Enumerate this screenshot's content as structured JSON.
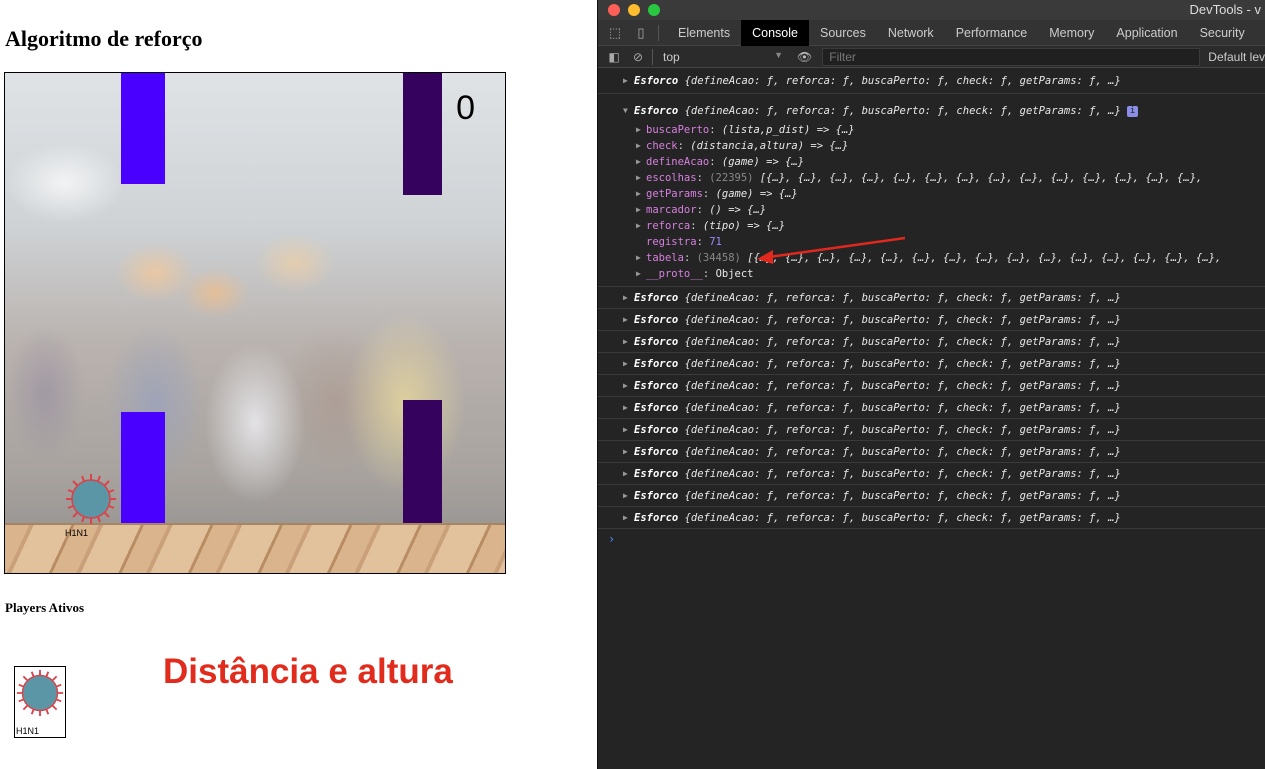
{
  "page": {
    "title": "Algoritmo de reforço",
    "score": "0",
    "bird_label": "H1N1",
    "players_title": "Players Ativos",
    "player_label": "H1N1",
    "caption": "Distância e altura"
  },
  "colors": {
    "pipe_front": "#4a00ff",
    "pipe_back": "#35025e",
    "caption": "#e02b1d",
    "virus_body": "#5b96a6",
    "virus_spikes": "#d9434a"
  },
  "devtools": {
    "window_title": "DevTools - v",
    "tabs": [
      "Elements",
      "Console",
      "Sources",
      "Network",
      "Performance",
      "Memory",
      "Application",
      "Security"
    ],
    "active_tab": "Console",
    "context": "top",
    "filter_placeholder": "Filter",
    "levels": "Default lev",
    "collapsed_entry_name": "Esforco",
    "collapsed_entry_preview": "{defineAcao: ƒ, reforca: ƒ, buscaPerto: ƒ, check: ƒ, getParams: ƒ, …}",
    "info_badge": "i",
    "expanded_props": [
      {
        "key": "buscaPerto",
        "value": "(lista,p_dist) => {…}",
        "expandable": true
      },
      {
        "key": "check",
        "value": "(distancia,altura) => {…}",
        "expandable": true
      },
      {
        "key": "defineAcao",
        "value": "(game) => {…}",
        "expandable": true
      },
      {
        "key": "escolhas",
        "count": "(22395)",
        "value": "[{…}, {…}, {…}, {…}, {…}, {…}, {…}, {…}, {…}, {…}, {…}, {…}, {…}, {…},",
        "expandable": true
      },
      {
        "key": "getParams",
        "value": "(game) => {…}",
        "expandable": true
      },
      {
        "key": "marcador",
        "value": "() => {…}",
        "expandable": true
      },
      {
        "key": "reforca",
        "value": "(tipo) => {…}",
        "expandable": true
      },
      {
        "key": "registra",
        "value": "71",
        "expandable": false
      },
      {
        "key": "tabela",
        "count": "(34458)",
        "value": "[{…}, {…}, {…}, {…}, {…}, {…}, {…}, {…}, {…}, {…}, {…}, {…}, {…}, {…}, {…},",
        "expandable": true
      },
      {
        "key": "__proto__",
        "value": "Object",
        "expandable": true
      }
    ],
    "collapsed_rows_after": 11,
    "prompt": "›"
  }
}
